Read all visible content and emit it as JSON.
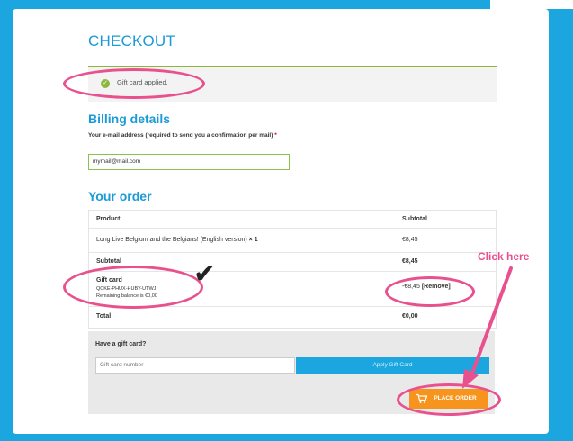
{
  "checkout": {
    "title": "CHECKOUT",
    "notice": {
      "icon": "check-circle-icon",
      "text": "Gift card applied."
    },
    "billing": {
      "heading": "Billing details",
      "email_label": "Your e-mail address (required to send you a confirmation per mail)",
      "required_mark": "*",
      "email_value": "mymail@mail.com"
    },
    "order": {
      "heading": "Your order",
      "columns": {
        "product": "Product",
        "subtotal": "Subtotal"
      },
      "item": {
        "name": "Long Live Belgium and the Belgians! (English version)",
        "qty": "× 1",
        "amount": "€8,45"
      },
      "subtotal": {
        "label": "Subtotal",
        "amount": "€8,45"
      },
      "gift_card": {
        "label": "Gift card",
        "code": "QCKE-PHUX-HUBY-UTWJ",
        "balance": "Remaining balance is €0,00",
        "amount": "-€8,45",
        "remove": "[Remove]"
      },
      "total": {
        "label": "Total",
        "amount": "€0,00"
      }
    },
    "gift": {
      "heading": "Have a gift card?",
      "placeholder": "Gift card number",
      "apply_label": "Apply Gift Card"
    },
    "place_order": {
      "label": "PLACE ORDER",
      "icon": "cart-icon"
    }
  },
  "annotations": {
    "click_here": "Click here",
    "checkmark": "✔"
  },
  "colors": {
    "accent": "#1ba6e0",
    "highlight": "#e8518d",
    "success": "#8bb83a",
    "button": "#f7941d"
  }
}
